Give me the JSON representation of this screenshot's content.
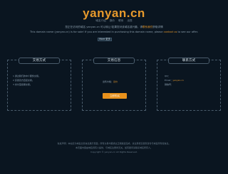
{
  "header": {
    "logo": "yanyan.cn",
    "nav": [
      "域名介绍",
      "报价",
      "联系",
      "出售"
    ]
  },
  "notice": {
    "line1_prefix": "您正在访问的域名 yanyan.cn 可以转让!如果您对该域名感兴趣，请",
    "line1_link": "联系我们",
    "line1_suffix": "获取详情",
    "line2_prefix": "This domain name (yanyan.cn) is for sale! If you are interested in purchasing this domain name, please",
    "line2_link": "contact us",
    "line2_suffix": "to see our offer.",
    "more_btn": "More 更多"
  },
  "cards": {
    "trade_method": {
      "title": "交易方式",
      "lines": [
        "1 通过我们的中介服务交易。",
        "2 买卖双方直接交易。",
        "3 支付宝担保交易。"
      ]
    },
    "trade_info": {
      "title": "交易信息",
      "price_label": "出售价格：",
      "price_value": "议价",
      "buy_button": "立即购买"
    },
    "contact": {
      "title": "联系方式",
      "lines": [
        "QQ：",
        "Email：",
        "微信号："
      ],
      "email_value": "yanyan.cn"
    }
  },
  "footer": {
    "line1": "免责声明：本站仅为域名出售信息展示页面，所有交易均需通过正规渠道完成，请注意核实卖家身份与域名所有权信息。",
    "line2": "本页面内容由域名持有人提供，与域名注册商无关。如有疑问请联系域名所有人。",
    "line3": "Copyright © yanyan.cn All Rights Reserved."
  }
}
